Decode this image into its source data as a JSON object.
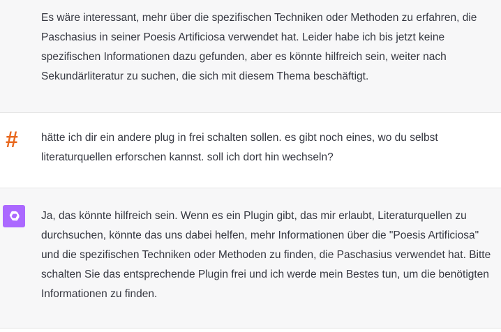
{
  "messages": [
    {
      "role": "assistant",
      "text": "Es wäre interessant, mehr über die spezifischen Techniken oder Methoden zu erfahren, die Paschasius in seiner Poesis Artificiosa verwendet hat. Leider habe ich bis jetzt keine spezifischen Informationen dazu gefunden, aber es könnte hilfreich sein, weiter nach Sekundärliteratur zu suchen, die sich mit diesem Thema beschäftigt."
    },
    {
      "role": "user",
      "avatar": "#",
      "text": "hätte ich dir ein andere plug in frei schalten sollen. es gibt noch eines, wo du selbst literaturquellen erforschen kannst. soll ich dort hin wechseln?"
    },
    {
      "role": "assistant",
      "icon": "openai-logo-icon",
      "text": "Ja, das könnte hilfreich sein. Wenn es ein Plugin gibt, das mir erlaubt, Literaturquellen zu durchsuchen, könnte das uns dabei helfen, mehr Informationen über die \"Poesis Artificiosa\" und die spezifischen Techniken oder Methoden zu finden, die Paschasius verwendet hat. Bitte schalten Sie das entsprechende Plugin frei und ich werde mein Bestes tun, um die benötigten Informationen zu finden."
    }
  ],
  "colors": {
    "assistant_bg": "#f7f7f8",
    "user_avatar": "#e8681e",
    "assistant_avatar": "#ab68ff"
  }
}
